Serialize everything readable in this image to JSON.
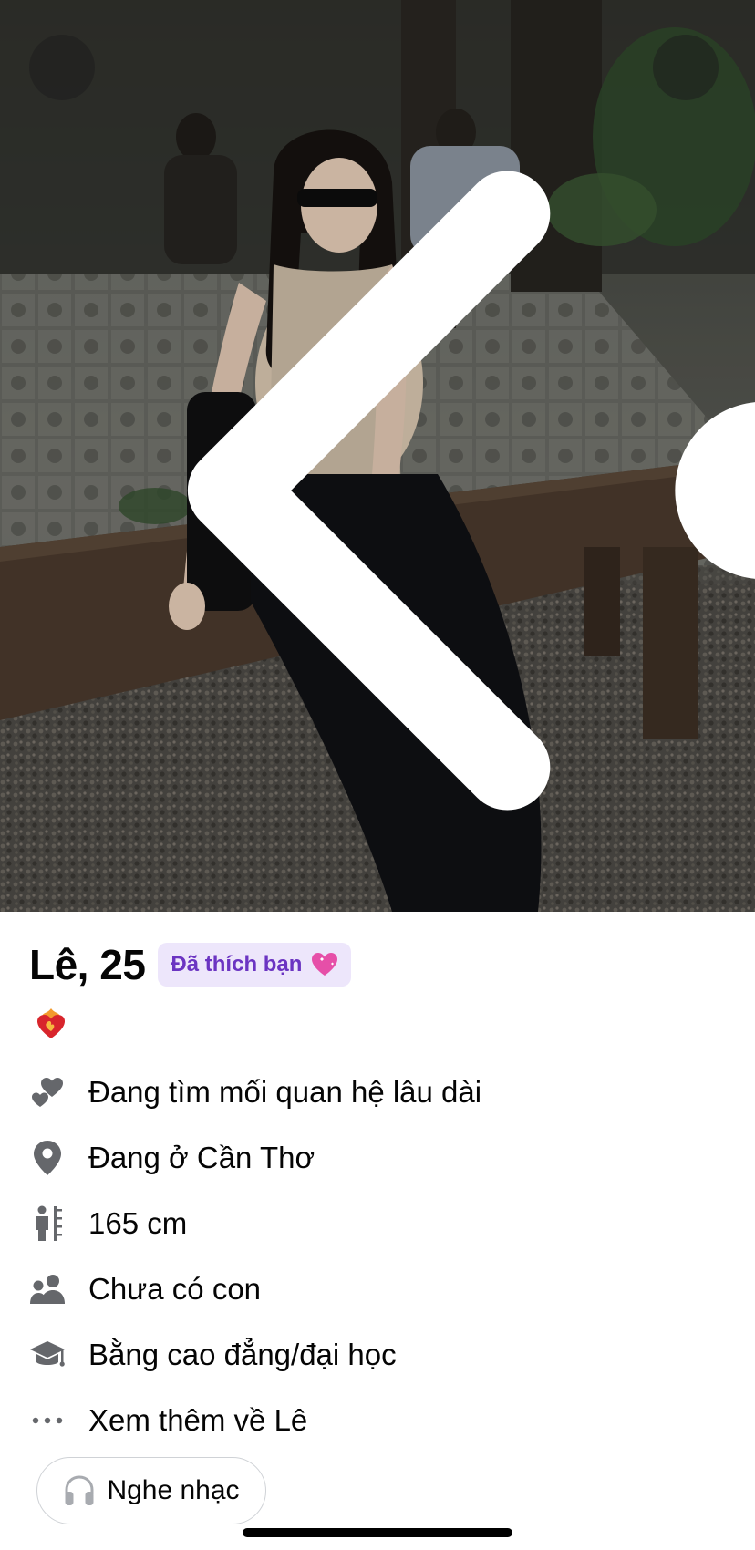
{
  "profile": {
    "name_age": "Lê, 25",
    "liked_badge": "Đã thích bạn",
    "details": [
      {
        "icon": "hearts-icon",
        "text": "Đang tìm mối quan hệ lâu dài"
      },
      {
        "icon": "location-pin-icon",
        "text": "Đang ở Cần Thơ"
      },
      {
        "icon": "height-icon",
        "text": "165 cm"
      },
      {
        "icon": "children-icon",
        "text": "Chưa có con"
      },
      {
        "icon": "graduation-cap-icon",
        "text": "Bằng cao đẳng/đại học"
      },
      {
        "icon": "more-dots-icon",
        "text": "Xem thêm về Lê"
      }
    ]
  },
  "music": {
    "label": "Nghe nhạc"
  },
  "colors": {
    "badge_bg": "#ede6fb",
    "badge_text": "#6b34c2",
    "icon_gray": "#65676b"
  }
}
